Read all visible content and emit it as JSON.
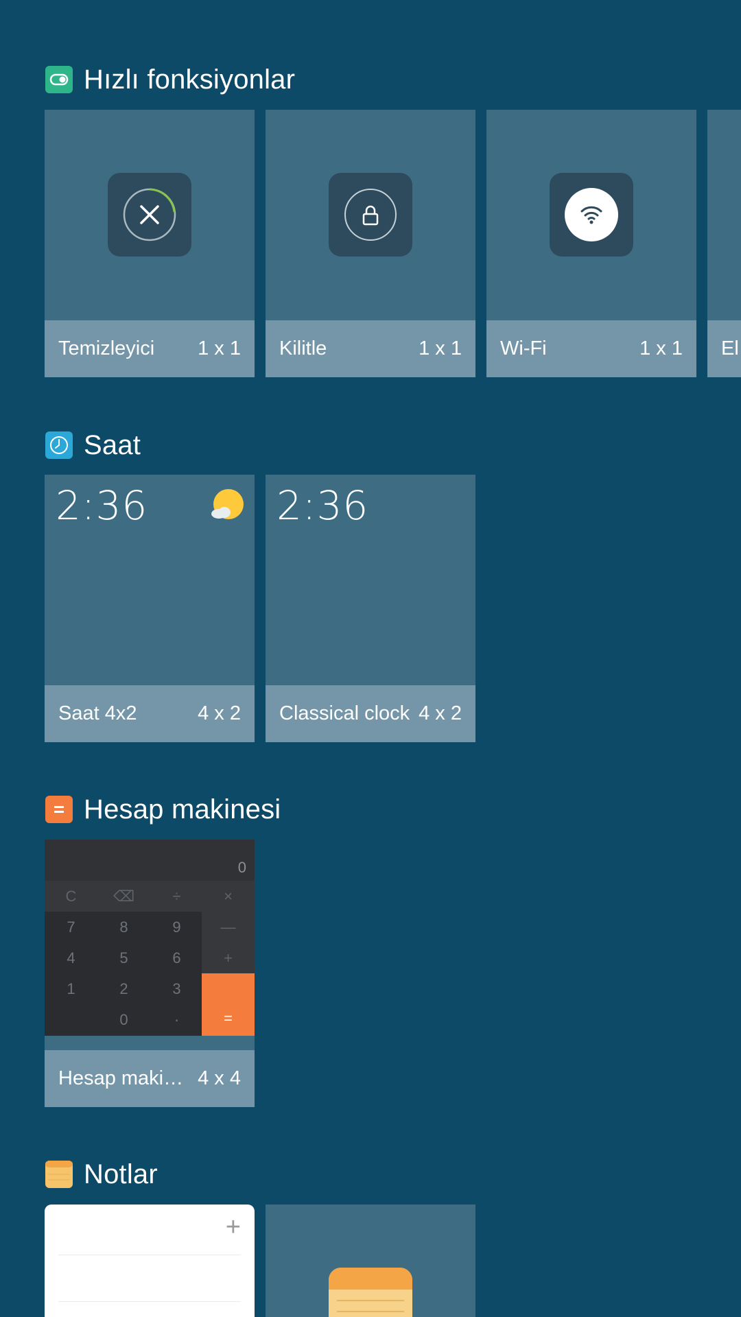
{
  "sections": {
    "quick": {
      "title": "Hızlı fonksiyonlar",
      "icon": "toggle-switch-icon",
      "widgets": [
        {
          "name": "Temizleyici",
          "size": "1 x 1",
          "icon": "cleaner-icon"
        },
        {
          "name": "Kilitle",
          "size": "1 x 1",
          "icon": "lock-icon"
        },
        {
          "name": "Wi-Fi",
          "size": "1 x 1",
          "icon": "wifi-icon"
        },
        {
          "name": "El",
          "size": ""
        }
      ]
    },
    "clock": {
      "title": "Saat",
      "icon": "clock-icon",
      "widgets": [
        {
          "name": "Saat 4x2",
          "size": "4 x 2",
          "time": "2:36",
          "weather_icon": "partly-cloudy-icon"
        },
        {
          "name": "Classical clock",
          "size": "4 x 2",
          "time": "2:36"
        }
      ]
    },
    "calculator": {
      "title": "Hesap makinesi",
      "icon": "calculator-icon",
      "widgets": [
        {
          "name": "Hesap makin...",
          "size": "4 x 4",
          "display": "0",
          "keys": {
            "clear": "C",
            "backspace": "⌫",
            "divide": "÷",
            "multiply": "×",
            "k7": "7",
            "k8": "8",
            "k9": "9",
            "minus": "—",
            "k4": "4",
            "k5": "5",
            "k6": "6",
            "plus": "+",
            "k1": "1",
            "k2": "2",
            "k3": "3",
            "k0": "0",
            "dot": "·",
            "equals": "="
          }
        }
      ]
    },
    "notes": {
      "title": "Notlar",
      "icon": "notes-icon",
      "widgets": [
        {
          "name": "notes-list",
          "add_label": "+"
        },
        {
          "name": "notes-app",
          "icon": "notepad-icon"
        }
      ]
    }
  },
  "colors": {
    "background": "#0d4a67",
    "card": "#3d6c83",
    "card_footer": "#7496a8",
    "accent_green": "#8bc34a",
    "calc_orange": "#f47c3c"
  }
}
